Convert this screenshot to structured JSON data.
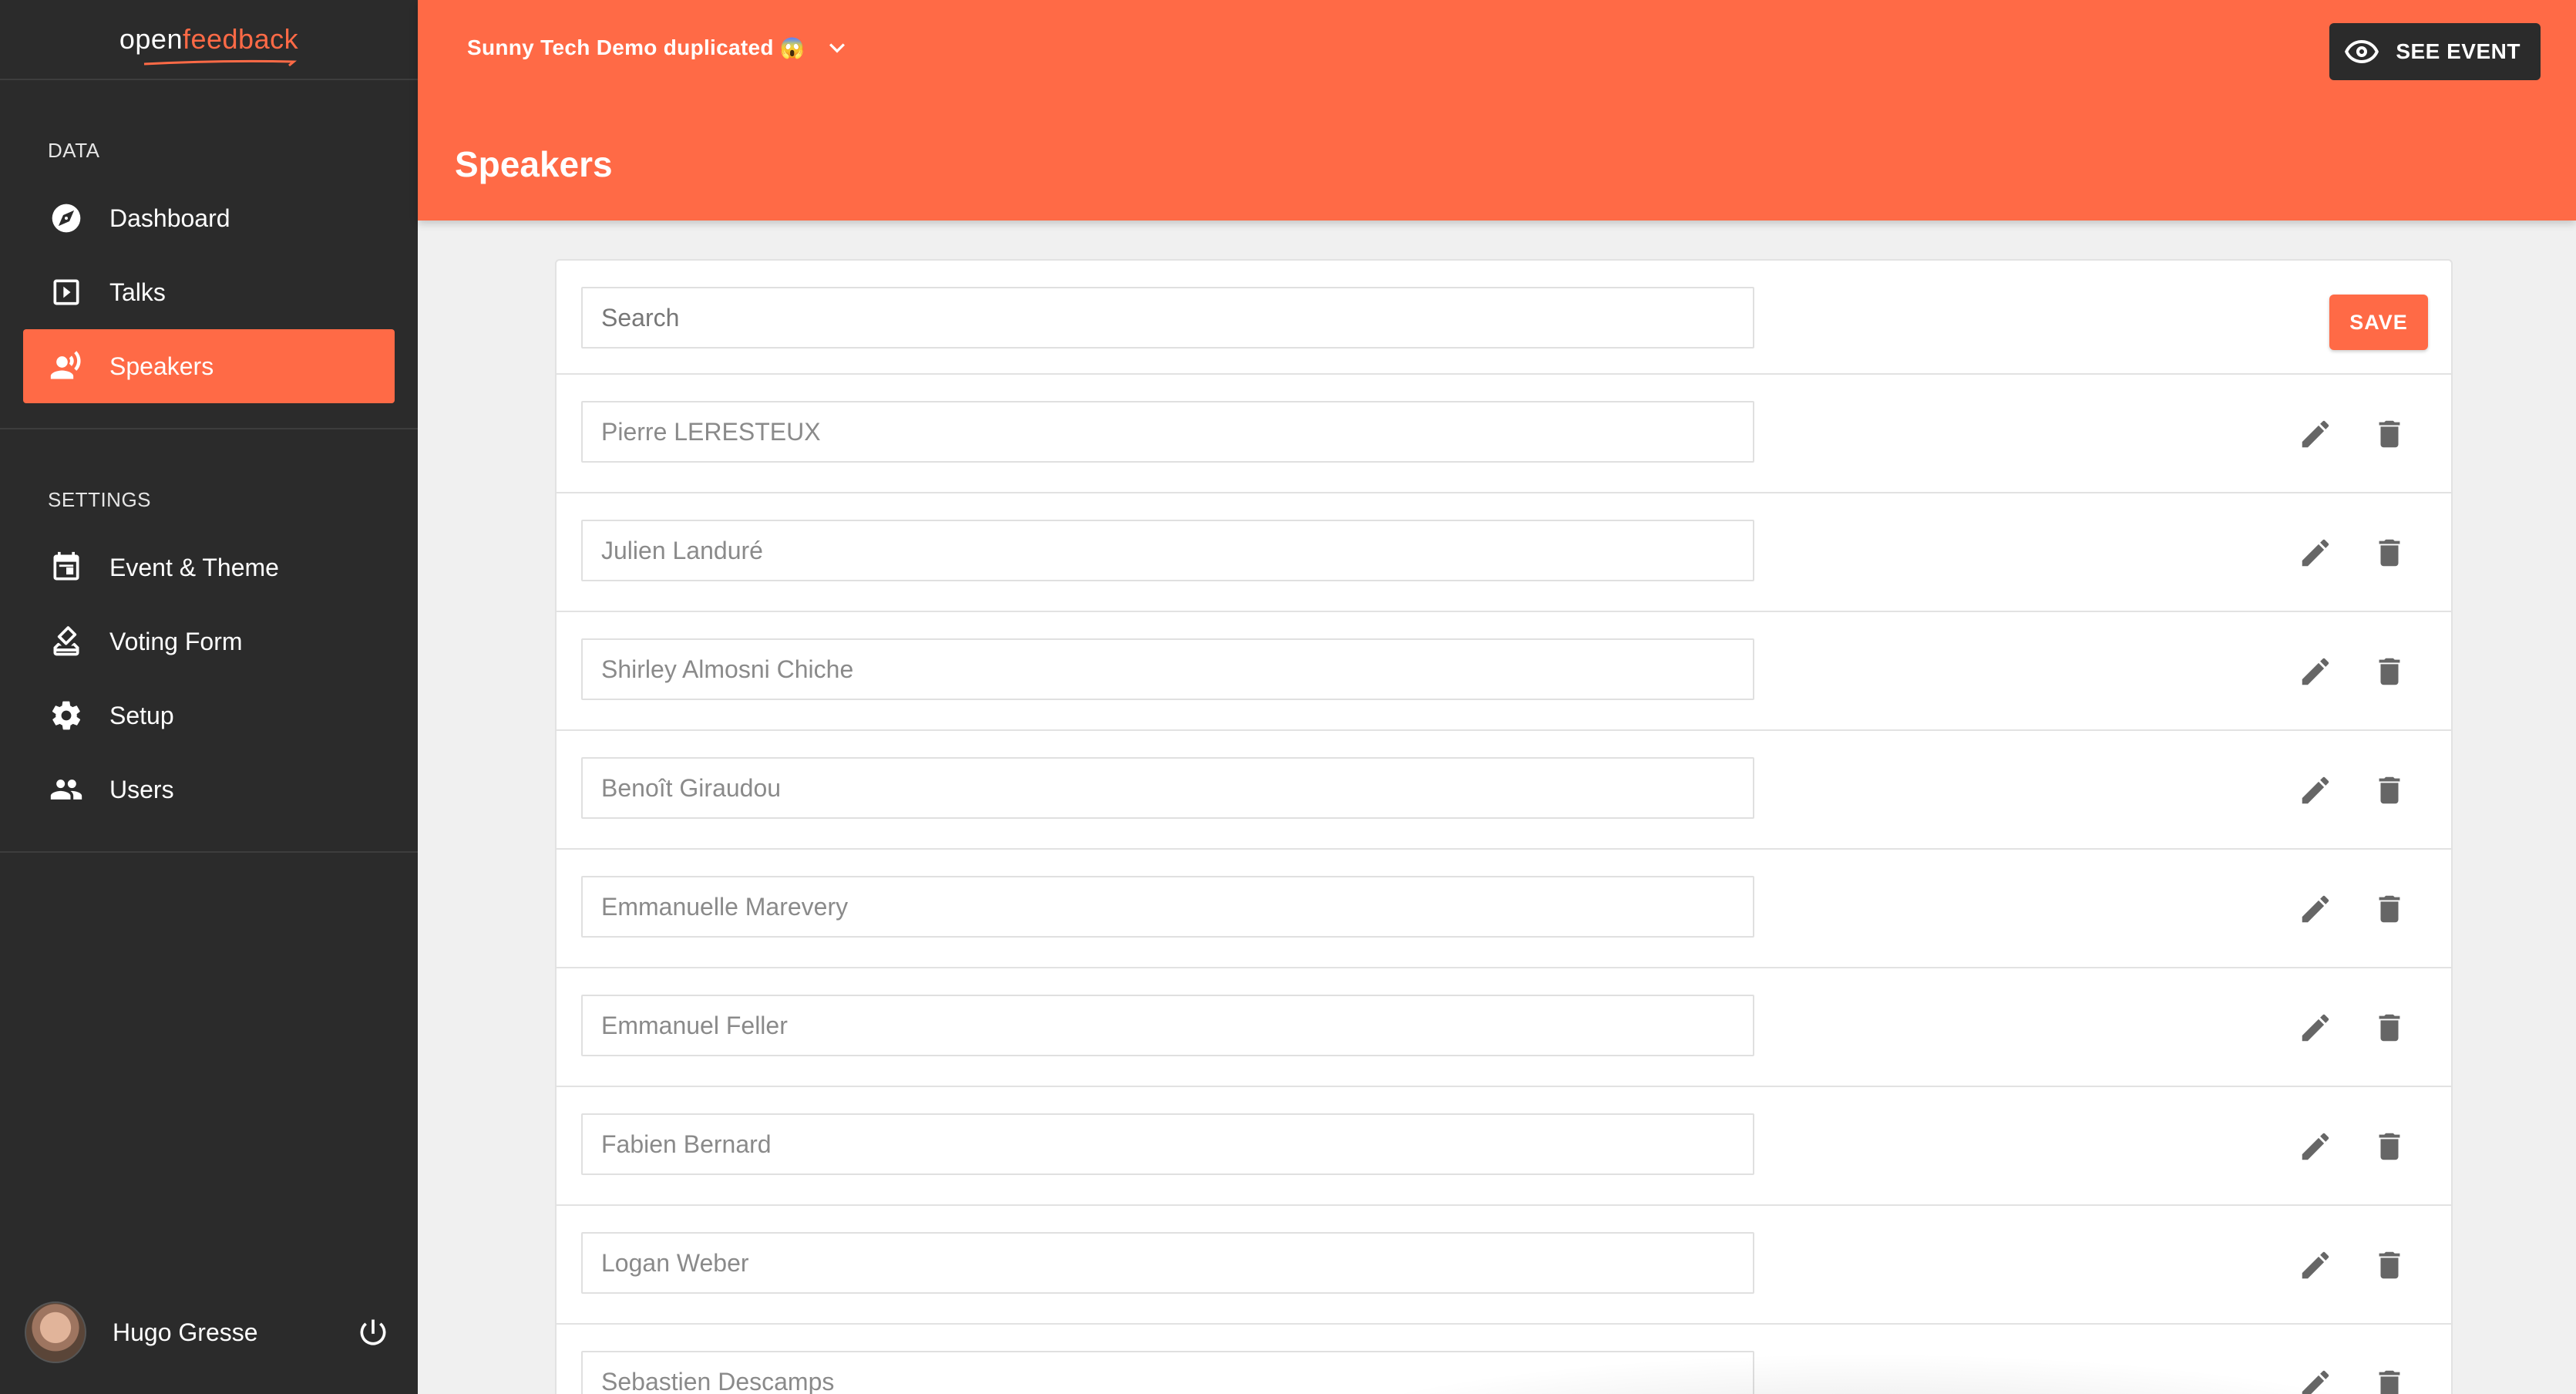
{
  "app": {
    "logo_prefix": "open",
    "logo_accent": "feedback",
    "brand_color": "#ff6a46",
    "sidebar_color": "#2b2b2b"
  },
  "sidebar": {
    "sections": [
      {
        "title": "DATA",
        "items": [
          {
            "label": "Dashboard",
            "icon": "compass-icon",
            "active": false
          },
          {
            "label": "Talks",
            "icon": "play-box-icon",
            "active": false
          },
          {
            "label": "Speakers",
            "icon": "speaker-voice-icon",
            "active": true
          }
        ]
      },
      {
        "title": "SETTINGS",
        "items": [
          {
            "label": "Event & Theme",
            "icon": "calendar-icon",
            "active": false
          },
          {
            "label": "Voting Form",
            "icon": "ballot-icon",
            "active": false
          },
          {
            "label": "Setup",
            "icon": "gear-icon",
            "active": false
          },
          {
            "label": "Users",
            "icon": "people-icon",
            "active": false
          }
        ]
      }
    ],
    "user": {
      "name": "Hugo Gresse"
    }
  },
  "header": {
    "event_name": "Sunny Tech Demo duplicated",
    "event_emoji": "😱",
    "see_event_label": "SEE EVENT",
    "page_title": "Speakers"
  },
  "main": {
    "search_placeholder": "Search",
    "save_label": "SAVE",
    "speakers": [
      "Pierre LERESTEUX",
      "Julien Landuré",
      "Shirley Almosni Chiche",
      "Benoît Giraudou",
      "Emmanuelle Marevery",
      "Emmanuel Feller",
      "Fabien Bernard",
      "Logan Weber",
      "Sebastien Descamps"
    ]
  }
}
